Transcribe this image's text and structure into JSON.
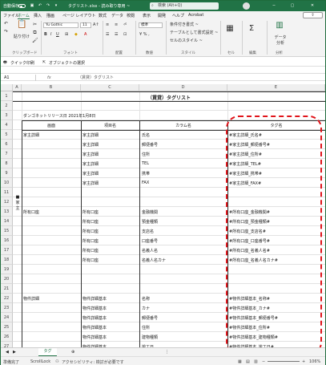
{
  "titlebar": {
    "autosave_label": "自動保存",
    "file_title": "タグリスト.xlsx - 読み取り専用 ~",
    "search_placeholder": "検索 (Alt+Q)",
    "accent": "#217346"
  },
  "menu": {
    "tabs": [
      "ファイル",
      "ホーム",
      "挿入",
      "描画",
      "ページ レイアウト",
      "数式",
      "データ",
      "校閲",
      "表示",
      "開発",
      "ヘルプ",
      "Acrobat"
    ],
    "active_tab": "ホーム"
  },
  "ribbon": {
    "paste_label": "貼り付け",
    "clipboard_label": "クリップボード",
    "font_name": "Yu Gothic",
    "font_size": "11",
    "font_group_label": "フォント",
    "align_group_label": "配置",
    "number_group_label": "数値",
    "number_format": "標準",
    "cond_format": "条件付き書式 ~",
    "table_format": "テーブルとして書式設定 ~",
    "cell_style": "セルのスタイル ~",
    "style_group_label": "スタイル",
    "cells_label": "セル",
    "edit_label": "編集",
    "data_analysis": "データ 分析",
    "analysis_label": "分析"
  },
  "quick_access": {
    "quick_print": "クイック印刷",
    "object_select": "オブジェクトの選択"
  },
  "formula_bar": {
    "name_box": "A1",
    "fx": "fx",
    "value": "（賃貸）タグリスト"
  },
  "grid": {
    "columns": [
      "A",
      "B",
      "C",
      "D",
      "E"
    ],
    "sheet_title": "（賃貸）タグリスト",
    "release_date": "ダンゴネットリリース日 2021年1月8日",
    "headers": {
      "screen": "画面",
      "item": "項目名",
      "column": "カラム名",
      "tag": "タグ名"
    },
    "side_label": "■\n家\n主",
    "rows": [
      {
        "n": "1",
        "a": "",
        "b": "",
        "c": "",
        "d": "",
        "e": ""
      },
      {
        "n": "2",
        "a": "",
        "b": "",
        "c": "",
        "d": "",
        "e": ""
      },
      {
        "n": "3",
        "a": "",
        "b": "",
        "c": "",
        "d": "",
        "e": ""
      },
      {
        "n": "4",
        "a": "",
        "b": "",
        "c": "",
        "d": "",
        "e": ""
      },
      {
        "n": "5",
        "a": "",
        "b": "家主詳細",
        "c": "家主詳細",
        "d": "氏名",
        "e": "#家主詳細_氏名#"
      },
      {
        "n": "6",
        "a": "",
        "b": "",
        "c": "家主詳細",
        "d": "郵便番号",
        "e": "#家主詳細_郵便番号#"
      },
      {
        "n": "7",
        "a": "",
        "b": "",
        "c": "家主詳細",
        "d": "住所",
        "e": "#家主詳細_住所#"
      },
      {
        "n": "8",
        "a": "",
        "b": "",
        "c": "家主詳細",
        "d": "TEL",
        "e": "#家主詳細_TEL#"
      },
      {
        "n": "9",
        "a": "",
        "b": "",
        "c": "家主詳細",
        "d": "携帯",
        "e": "#家主詳細_携帯#"
      },
      {
        "n": "10",
        "a": "",
        "b": "",
        "c": "家主詳細",
        "d": "FAX",
        "e": "#家主詳細_FAX#"
      },
      {
        "n": "11",
        "a": "",
        "b": "",
        "c": "",
        "d": "",
        "e": ""
      },
      {
        "n": "12",
        "a": "",
        "b": "",
        "c": "",
        "d": "",
        "e": ""
      },
      {
        "n": "13",
        "a": "",
        "b": "所有口座",
        "c": "所有口座",
        "d": "金融機関",
        "e": "#所有口座_金融機関#"
      },
      {
        "n": "14",
        "a": "",
        "b": "",
        "c": "所有口座",
        "d": "預金種類",
        "e": "#所有口座_預金種類#"
      },
      {
        "n": "15",
        "a": "",
        "b": "",
        "c": "所有口座",
        "d": "支店名",
        "e": "#所有口座_支店名#"
      },
      {
        "n": "16",
        "a": "",
        "b": "",
        "c": "所有口座",
        "d": "口座番号",
        "e": "#所有口座_口座番号#"
      },
      {
        "n": "17",
        "a": "",
        "b": "",
        "c": "所有口座",
        "d": "名義人名",
        "e": "#所有口座_名義人名#"
      },
      {
        "n": "18",
        "a": "",
        "b": "",
        "c": "所有口座",
        "d": "名義人名カナ",
        "e": "#所有口座_名義人名カナ#"
      },
      {
        "n": "19",
        "a": "",
        "b": "",
        "c": "",
        "d": "",
        "e": ""
      },
      {
        "n": "20",
        "a": "",
        "b": "",
        "c": "",
        "d": "",
        "e": ""
      },
      {
        "n": "21",
        "a": "",
        "b": "",
        "c": "",
        "d": "",
        "e": ""
      },
      {
        "n": "22",
        "a": "",
        "b": "物件詳細",
        "c": "物件詳細基本",
        "d": "名称",
        "e": "#物件詳細基本_名称#"
      },
      {
        "n": "23",
        "a": "",
        "b": "",
        "c": "物件詳細基本",
        "d": "カナ",
        "e": "#物件詳細基本_カナ#"
      },
      {
        "n": "24",
        "a": "",
        "b": "",
        "c": "物件詳細基本",
        "d": "郵便番号",
        "e": "#物件詳細基本_郵便番号#"
      },
      {
        "n": "25",
        "a": "",
        "b": "",
        "c": "物件詳細基本",
        "d": "住所",
        "e": "#物件詳細基本_住所#"
      },
      {
        "n": "26",
        "a": "",
        "b": "",
        "c": "物件詳細基本",
        "d": "建物種類",
        "e": "#物件詳細基本_建物種類#"
      },
      {
        "n": "27",
        "a": "",
        "b": "",
        "c": "物件詳細基本",
        "d": "竣工日",
        "e": "#物件詳細基本_竣工日#"
      }
    ]
  },
  "sheet_tabs": {
    "active": "タグ"
  },
  "status": {
    "ready": "準備完了",
    "scroll": "ScrollLock",
    "accessibility": "アクセシビリティ: 検討が必要です",
    "zoom": "106%"
  }
}
